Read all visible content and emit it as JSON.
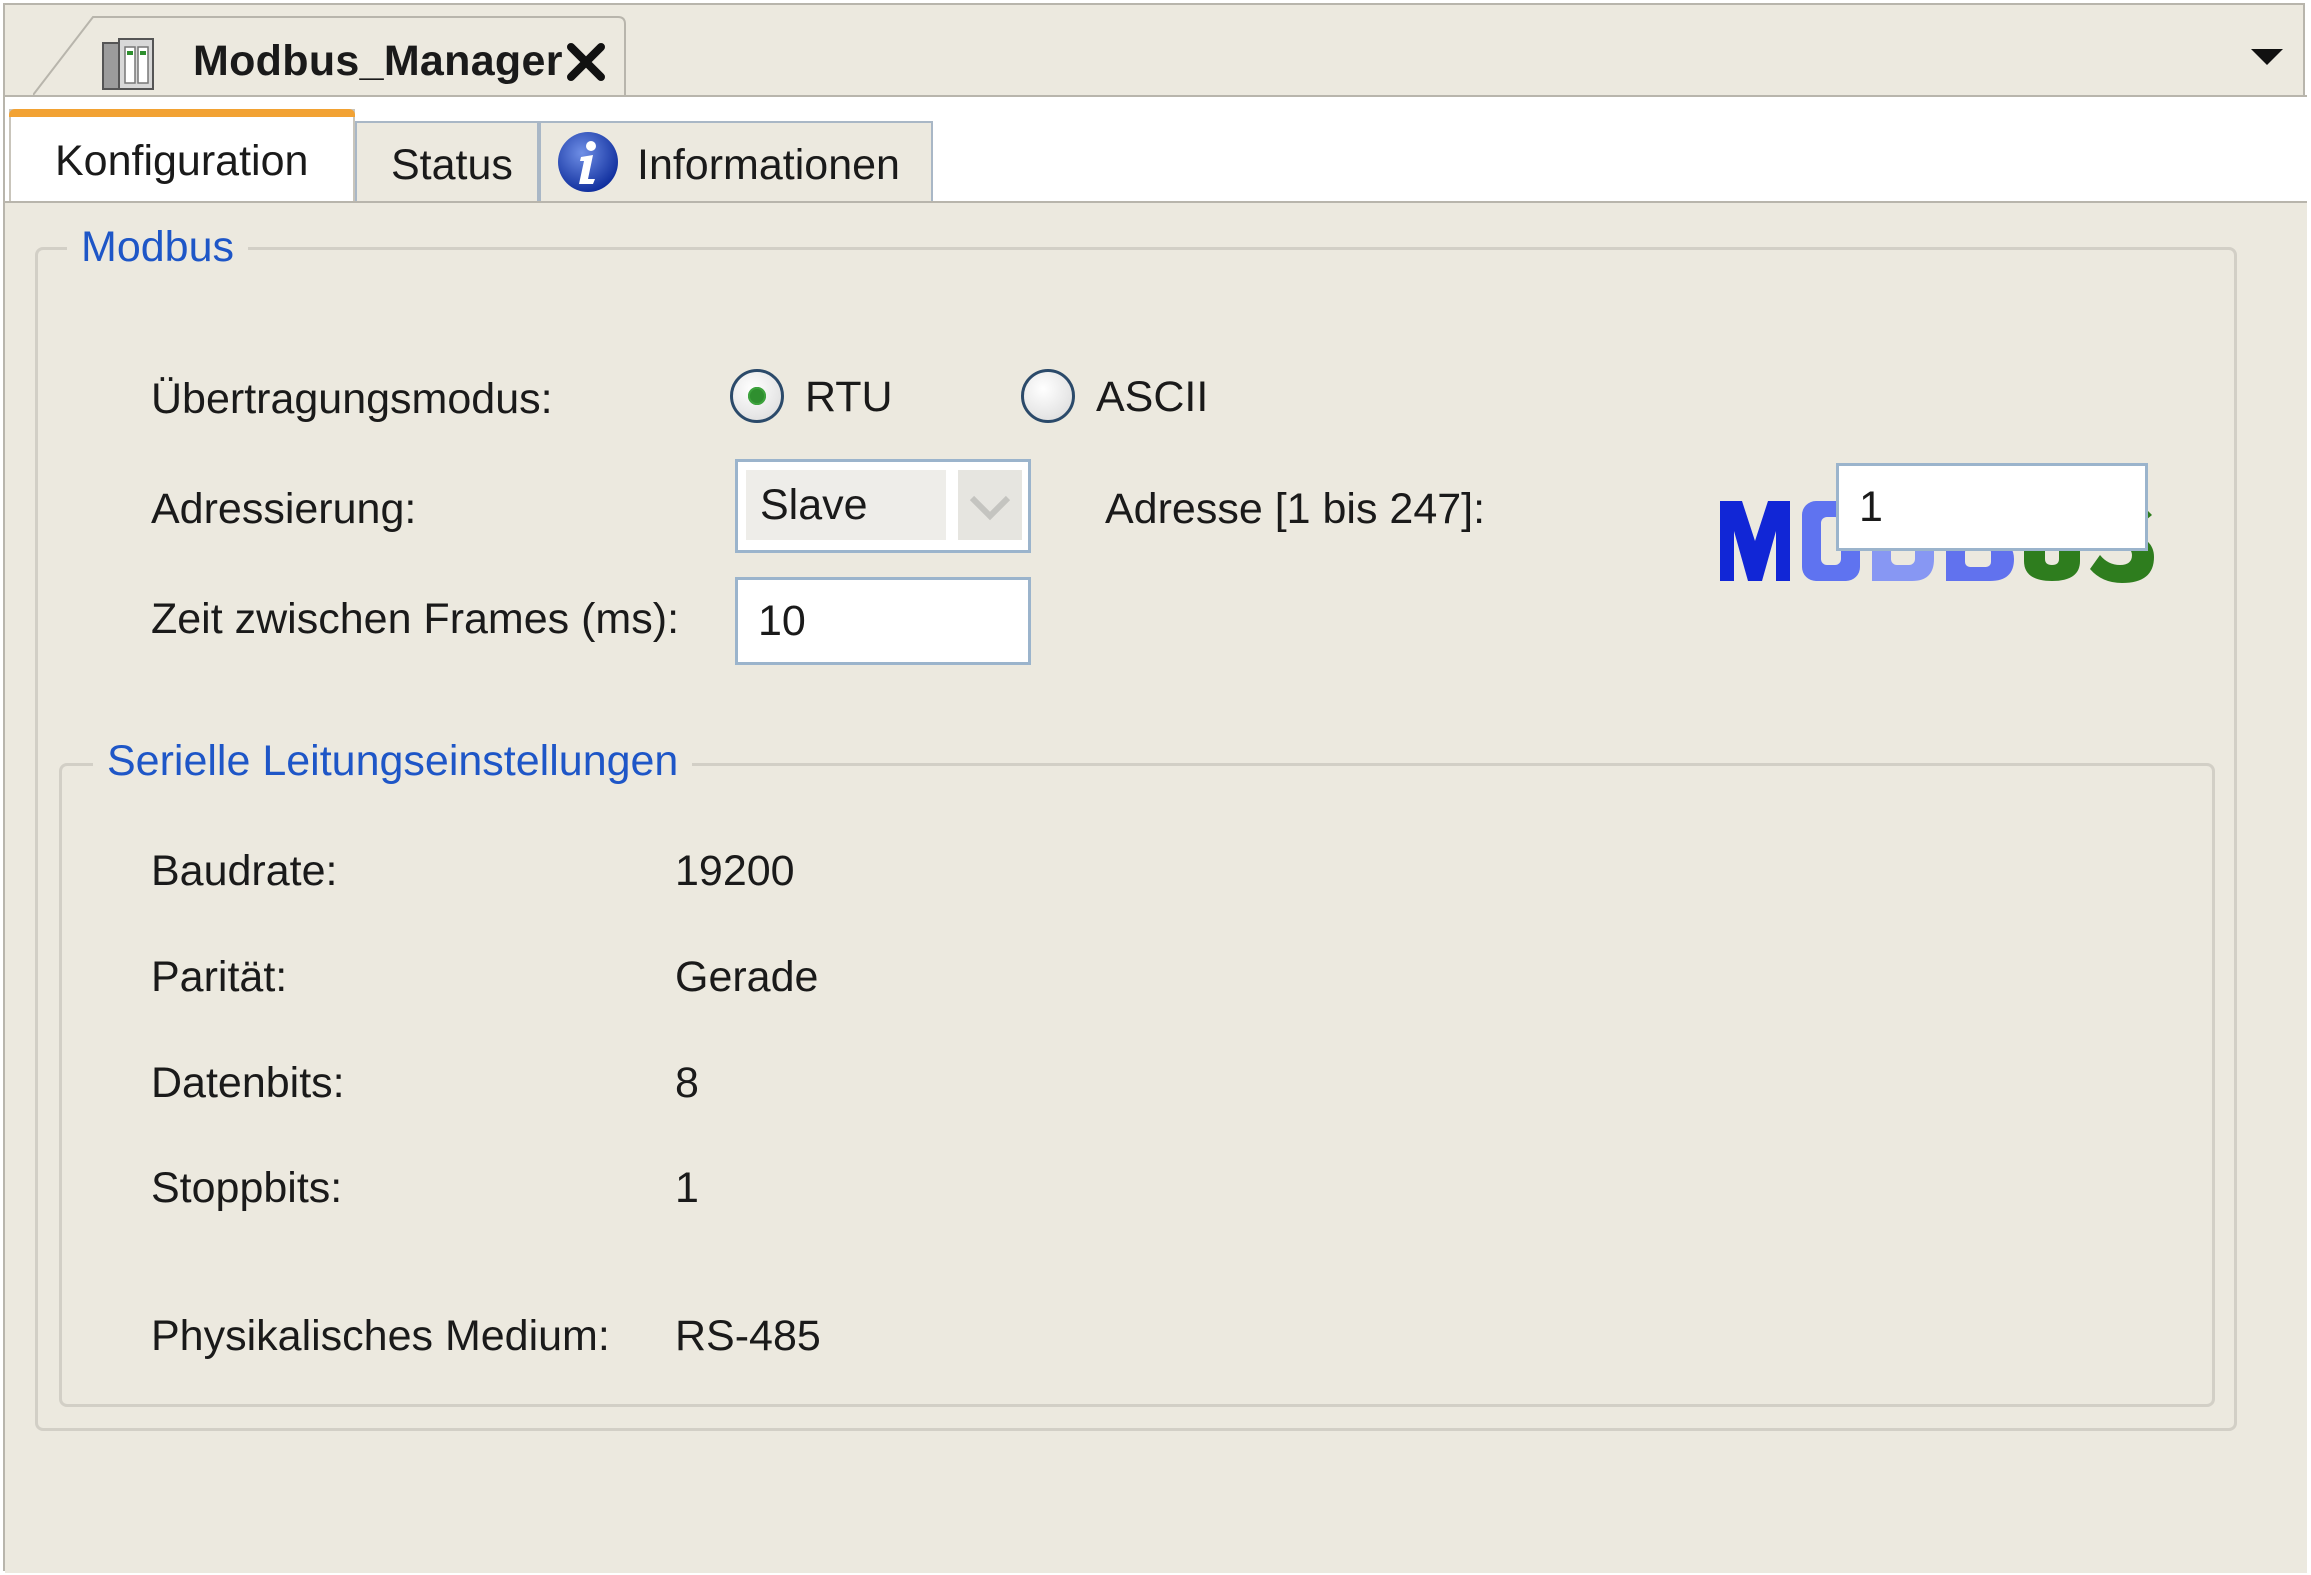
{
  "document_tab": {
    "title": "Modbus_Manager",
    "icon": "device-icon",
    "close_icon": "close-icon",
    "menu_icon": "chevron-down-icon"
  },
  "tabs": [
    {
      "label": "Konfiguration",
      "active": true
    },
    {
      "label": "Status",
      "active": false
    },
    {
      "label": "Informationen",
      "active": false,
      "icon": "info-icon"
    }
  ],
  "modbus_group": {
    "legend": "Modbus",
    "logo": "MODBUS",
    "transmission_mode": {
      "label": "Übertragungsmodus:",
      "options": [
        "RTU",
        "ASCII"
      ],
      "selected": "RTU"
    },
    "addressing": {
      "label": "Adressierung:",
      "value": "Slave"
    },
    "address": {
      "label": "Adresse [1 bis 247]:",
      "value": "1"
    },
    "frame_time": {
      "label": "Zeit zwischen Frames (ms):",
      "value": "10"
    }
  },
  "serial_group": {
    "legend": "Serielle Leitungseinstellungen",
    "rows": [
      {
        "label": "Baudrate:",
        "value": "19200"
      },
      {
        "label": "Parität:",
        "value": "Gerade"
      },
      {
        "label": "Datenbits:",
        "value": "8"
      },
      {
        "label": "Stoppbits:",
        "value": "1"
      },
      {
        "label": "Physikalisches Medium:",
        "value": "RS-485"
      }
    ]
  },
  "colors": {
    "panel_bg": "#ece9df",
    "legend_blue": "#1e56c7",
    "active_tab_accent": "#f2a233",
    "radio_selected": "#2f8f2f"
  }
}
